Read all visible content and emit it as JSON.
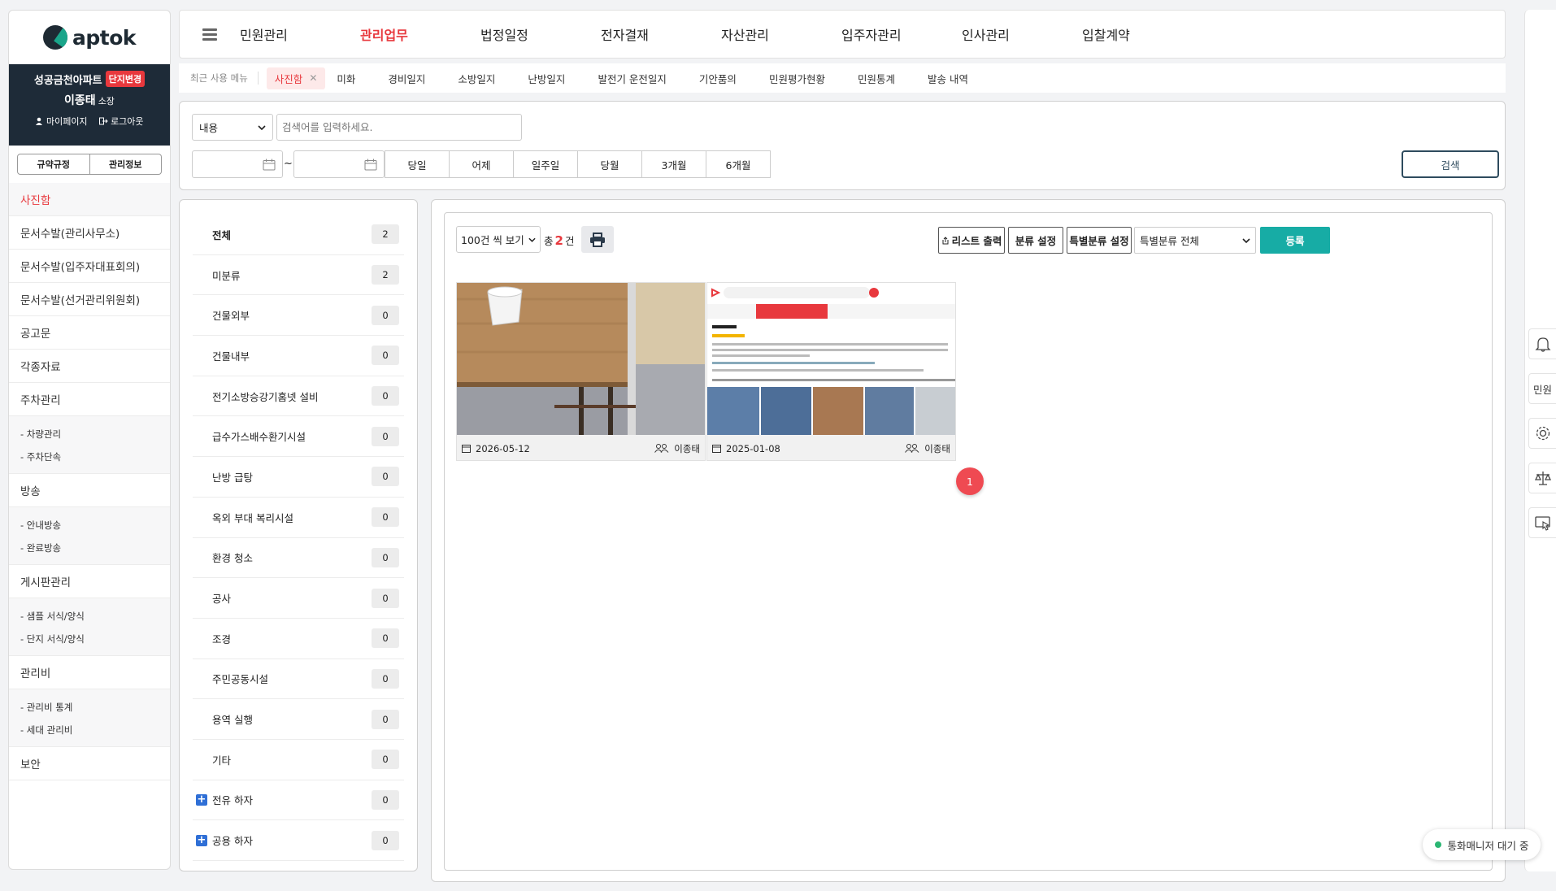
{
  "brand": {
    "logo_text": "aptok"
  },
  "profile": {
    "complex_name": "성공금천아파트",
    "change_badge": "단지변경",
    "user_name": "이종태",
    "user_role": "소장",
    "mypage": "마이페이지",
    "logout": "로그아웃"
  },
  "sidebar": {
    "buttons": [
      "규약규정",
      "관리정보"
    ],
    "items": [
      {
        "label": "사진함",
        "active": true
      },
      {
        "label": "문서수발(관리사무소)"
      },
      {
        "label": "문서수발(입주자대표회의)"
      },
      {
        "label": "문서수발(선거관리위원회)"
      },
      {
        "label": "공고문"
      },
      {
        "label": "각종자료"
      },
      {
        "label": "주차관리",
        "children": [
          "- 차량관리",
          "- 주차단속"
        ]
      },
      {
        "label": "방송",
        "children": [
          "- 안내방송",
          "- 완료방송"
        ]
      },
      {
        "label": "게시판관리",
        "children": [
          "- 샘플 서식/양식",
          "- 단지 서식/양식"
        ]
      },
      {
        "label": "관리비",
        "children": [
          "- 관리비 통계",
          "- 세대 관리비"
        ]
      },
      {
        "label": "보안"
      }
    ]
  },
  "topnav": {
    "items": [
      "민원관리",
      "관리업무",
      "법정일정",
      "전자결재",
      "자산관리",
      "입주자관리",
      "인사관리",
      "입찰계약"
    ],
    "active_index": 1
  },
  "recent": {
    "title": "최근 사용 메뉴",
    "current_tab": "사진함",
    "tabs": [
      "미화",
      "경비일지",
      "소방일지",
      "난방일지",
      "발전기 운전일지",
      "기안품의",
      "민원평가현황",
      "민원통계",
      "발송 내역"
    ]
  },
  "search": {
    "field_select": "내용",
    "placeholder": "검색어를 입력하세요.",
    "date_sep": "~",
    "periods": [
      "당일",
      "어제",
      "일주일",
      "당월",
      "3개월",
      "6개월"
    ],
    "search_button": "검색"
  },
  "categories": [
    {
      "name": "전체",
      "count": "2",
      "bold": true
    },
    {
      "name": "미분류",
      "count": "2"
    },
    {
      "name": "건물외부",
      "count": "0"
    },
    {
      "name": "건물내부",
      "count": "0"
    },
    {
      "name": "전기소방승강기홈넷 설비",
      "count": "0"
    },
    {
      "name": "급수가스배수환기시설",
      "count": "0"
    },
    {
      "name": "난방 급탕",
      "count": "0"
    },
    {
      "name": "옥외 부대 복리시설",
      "count": "0"
    },
    {
      "name": "환경 청소",
      "count": "0"
    },
    {
      "name": "공사",
      "count": "0"
    },
    {
      "name": "조경",
      "count": "0"
    },
    {
      "name": "주민공동시설",
      "count": "0"
    },
    {
      "name": "용역 실행",
      "count": "0"
    },
    {
      "name": "기타",
      "count": "0"
    },
    {
      "name": "전유 하자",
      "count": "0",
      "plus": true
    },
    {
      "name": "공용 하자",
      "count": "0",
      "plus": true
    }
  ],
  "list": {
    "per_page": "100건 씩 보기",
    "total_prefix": "총",
    "total_count": "2",
    "total_suffix": "건",
    "list_print": "리스트 출력",
    "category_setting": "분류 설정",
    "special_category_setting": "특별분류 설정",
    "special_category_select": "특별분류 전체",
    "register": "등록"
  },
  "photos": [
    {
      "date": "2026-05-12",
      "author": "이종태"
    },
    {
      "date": "2025-01-08",
      "author": "이종태"
    }
  ],
  "pagination": {
    "current": "1"
  },
  "dock": {
    "complaint_label": "민원"
  },
  "status": {
    "text": "통화매니저 대기 중"
  },
  "colors": {
    "accent": "#e8383d",
    "teal": "#17aca5",
    "navy": "#1e2b38"
  }
}
